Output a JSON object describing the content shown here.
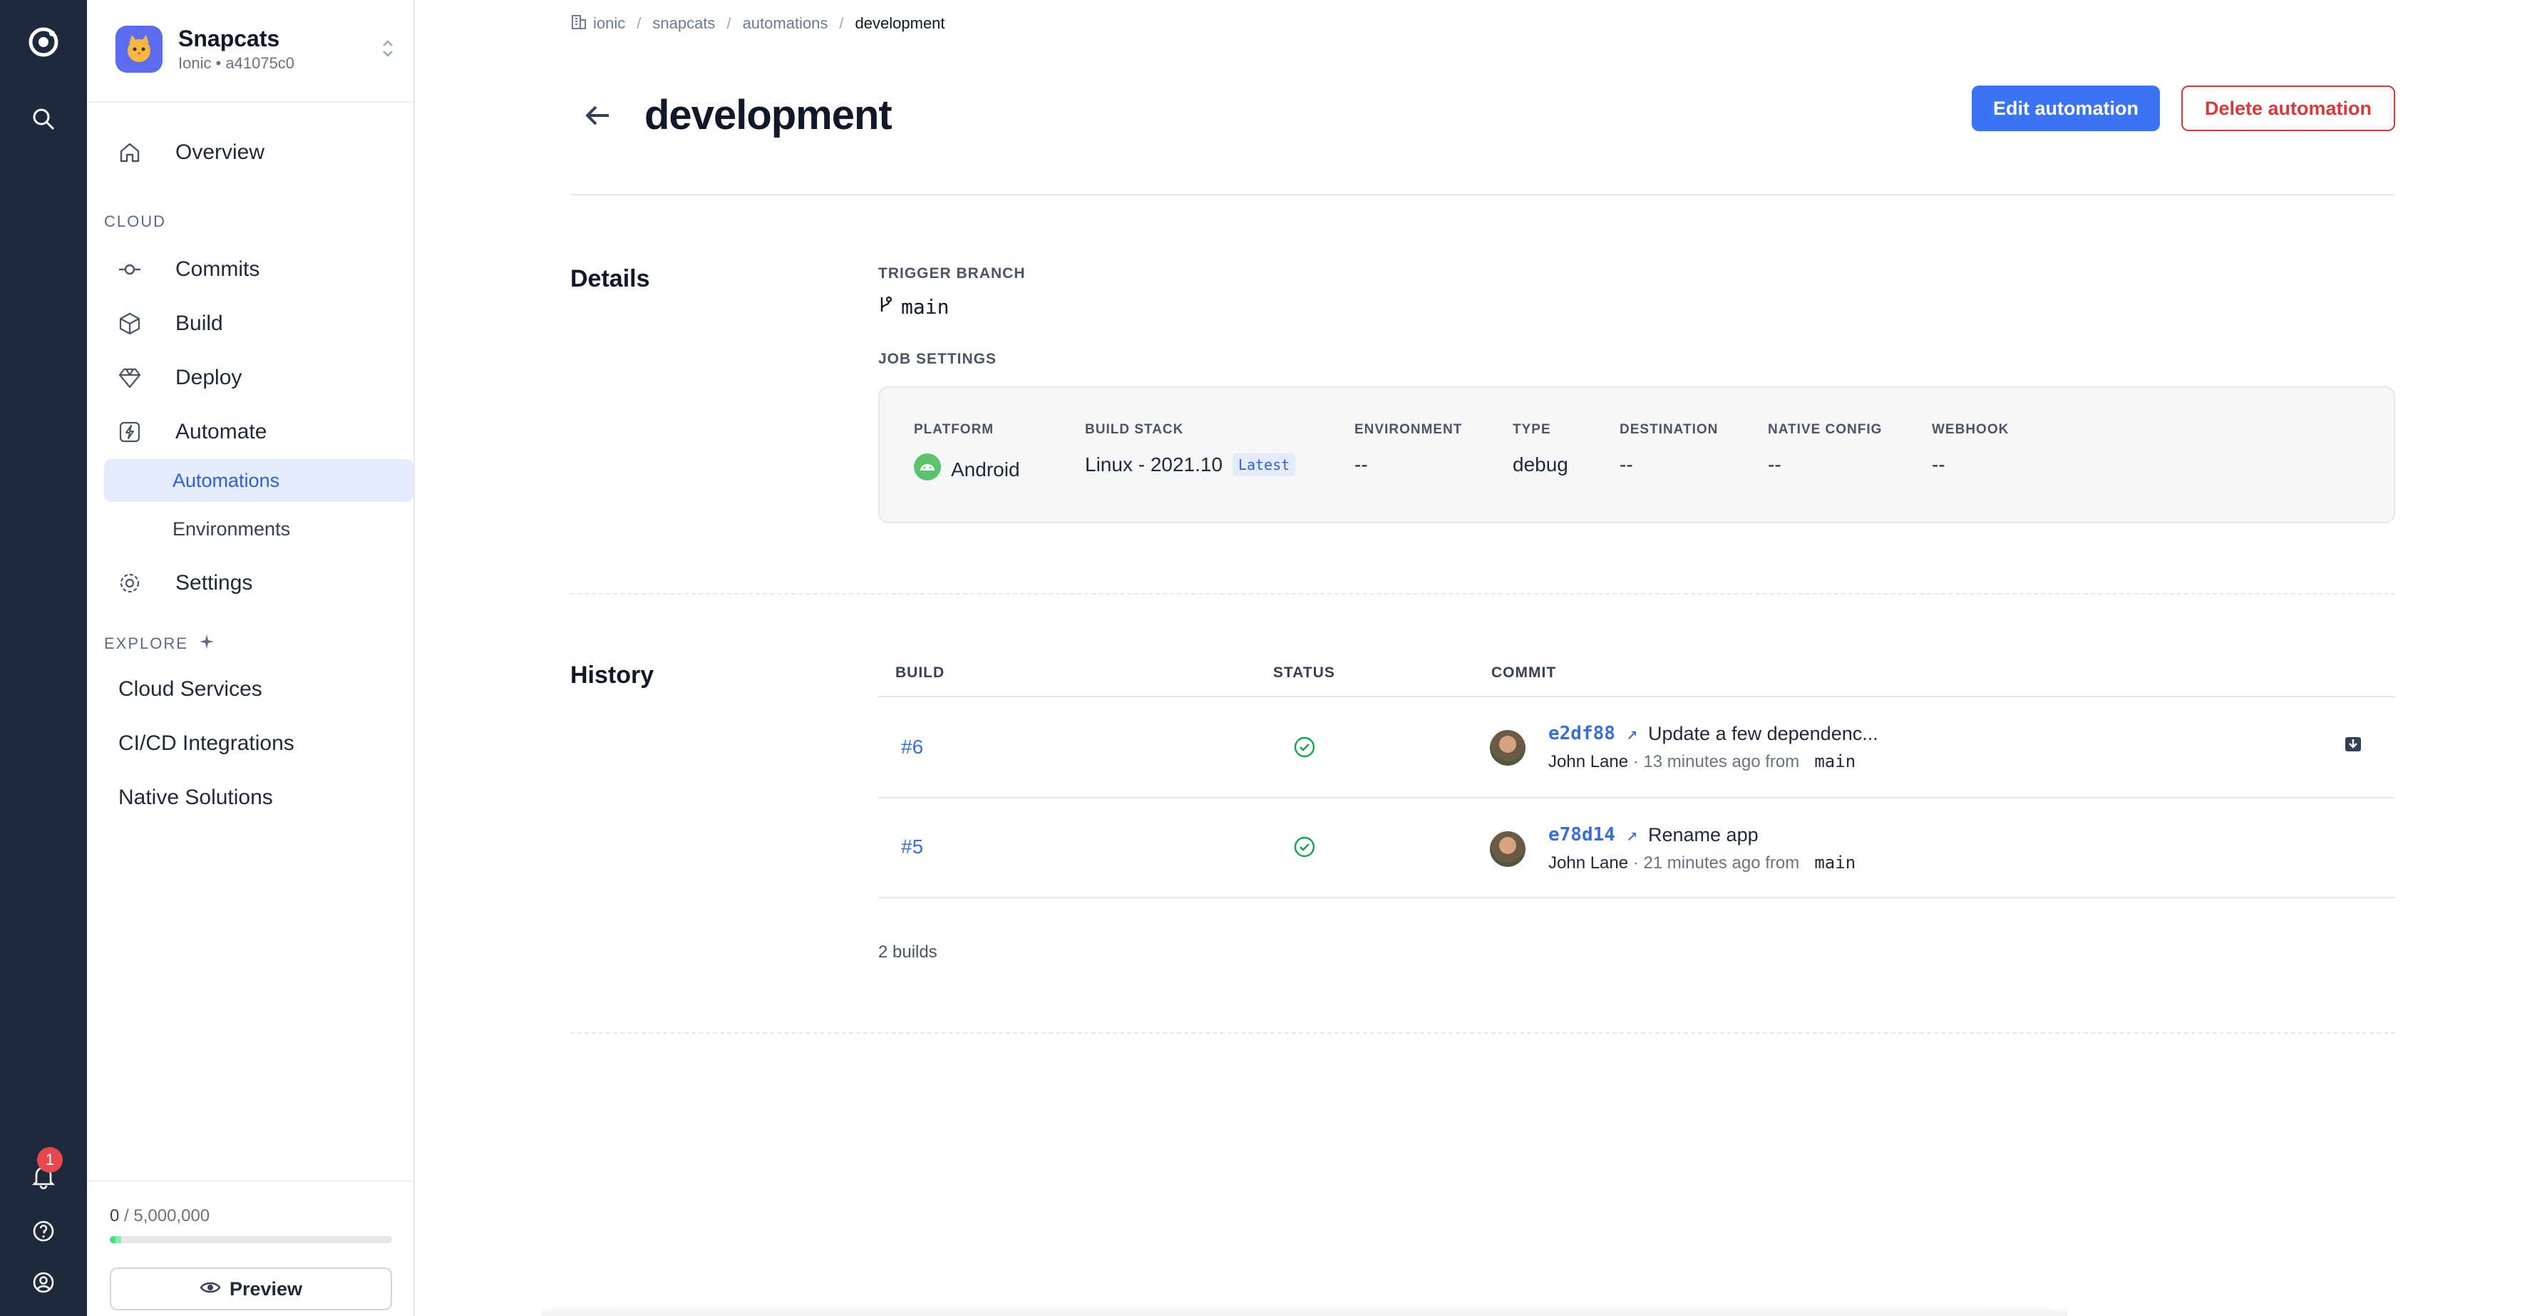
{
  "rail": {
    "notifications_count": "1"
  },
  "sidebar": {
    "app_name": "Snapcats",
    "app_sub": "Ionic • a41075c0",
    "overview": "Overview",
    "cloud_label": "CLOUD",
    "commits": "Commits",
    "build": "Build",
    "deploy": "Deploy",
    "automate": "Automate",
    "automations": "Automations",
    "environments": "Environments",
    "settings": "Settings",
    "explore_label": "EXPLORE",
    "explore_items": [
      "Cloud Services",
      "CI/CD Integrations",
      "Native Solutions"
    ],
    "usage_used": "0",
    "usage_total": "/ 5,000,000",
    "usage_fraction": 0.04,
    "preview": "Preview"
  },
  "breadcrumb": [
    "ionic",
    "snapcats",
    "automations",
    "development"
  ],
  "page": {
    "title": "development",
    "edit_button": "Edit automation",
    "delete_button": "Delete automation"
  },
  "details": {
    "heading": "Details",
    "trigger_label": "TRIGGER BRANCH",
    "trigger_branch": "main",
    "job_settings_label": "JOB SETTINGS",
    "job": {
      "platform_label": "PLATFORM",
      "platform": "Android",
      "stack_label": "BUILD STACK",
      "stack": "Linux - 2021.10",
      "stack_tag": "Latest",
      "env_label": "ENVIRONMENT",
      "env": "--",
      "type_label": "TYPE",
      "type": "debug",
      "dest_label": "DESTINATION",
      "dest": "--",
      "native_label": "NATIVE CONFIG",
      "native": "--",
      "webhook_label": "WEBHOOK",
      "webhook": "--"
    }
  },
  "history": {
    "heading": "History",
    "col_build": "BUILD",
    "col_status": "STATUS",
    "col_commit": "COMMIT",
    "rows": [
      {
        "build": "#6",
        "sha": "e2df88",
        "message": "Update a few dependenc...",
        "author": "John Lane",
        "when": " · 13 minutes ago from ",
        "branch": "main"
      },
      {
        "build": "#5",
        "sha": "e78d14",
        "message": "Rename app",
        "author": "John Lane",
        "when": " · 21 minutes ago from ",
        "branch": "main"
      }
    ],
    "count": "2 builds"
  },
  "colors": {
    "rail": "#1e2a3b",
    "accent": "#3b73f5",
    "danger": "#d73a3a",
    "success": "#16a34a"
  }
}
